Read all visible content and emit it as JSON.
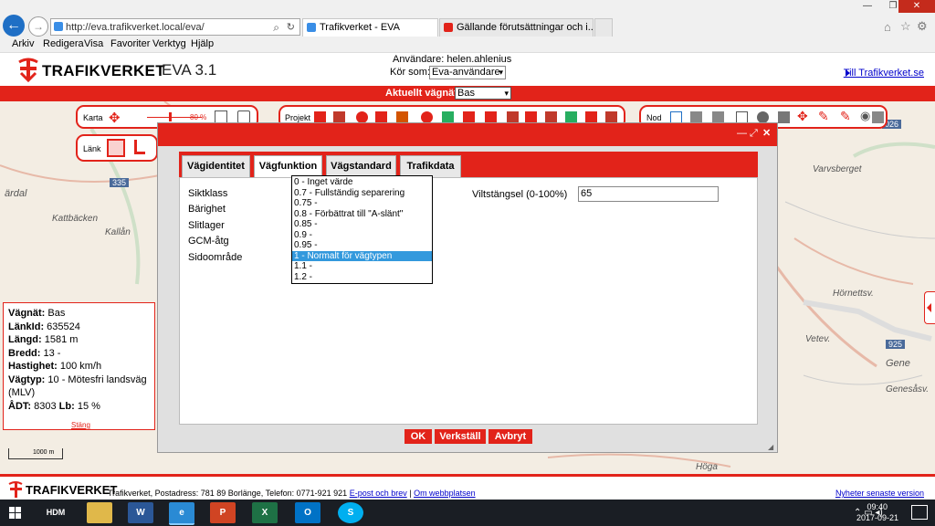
{
  "browser": {
    "url": "http://eva.trafikverket.local/eva/",
    "tabs": [
      {
        "label": "Trafikverket - EVA"
      },
      {
        "label": "Gällande förutsättningar och i..."
      }
    ],
    "menu": [
      "Arkiv",
      "Redigera",
      "Visa",
      "Favoriter",
      "Verktyg",
      "Hjälp"
    ]
  },
  "header": {
    "logo": "TRAFIKVERKET",
    "app_title": "EVA 3.1",
    "user": "Användare: helen.ahlenius",
    "role_label": "Kör som:",
    "role_value": "Eva-användare",
    "site_link": "Till Trafikverket.se",
    "net_label": "Aktuellt vägnät:",
    "net_value": "Bas"
  },
  "map": {
    "karta_label": "Karta",
    "zoom": "80 %",
    "lank_label": "Länk",
    "projekt_label": "Projekt",
    "nod_label": "Nod",
    "labels": [
      "ärdal",
      "Kattbäcken",
      "Kallån",
      "Varvsberget",
      "Hörnettsv.",
      "Vetev.",
      "Gene",
      "Genesåsv.",
      "Höga"
    ],
    "road_numbers": [
      "335",
      "026",
      "925"
    ],
    "scale": "1000 m"
  },
  "info": {
    "rows": [
      {
        "k": "Vägnät:",
        "v": " Bas"
      },
      {
        "k": "LänkId:",
        "v": " 635524"
      },
      {
        "k": "Längd:",
        "v": " 1581 m"
      },
      {
        "k": "Bredd:",
        "v": " 13 -"
      },
      {
        "k": "Hastighet:",
        "v": " 100 km/h"
      },
      {
        "k": "Vägtyp:",
        "v": " 10 - Mötesfri landsväg (MLV)"
      },
      {
        "k": "ÅDT:",
        "v": " 8303 "
      },
      {
        "k": "Lb:",
        "v": " 15 %"
      }
    ],
    "close": "Stäng"
  },
  "dialog": {
    "tabs": [
      "Vägidentitet",
      "Vägfunktion",
      "Vägstandard",
      "Trafikdata"
    ],
    "fields": [
      "Siktklass",
      "Bärighet",
      "Slitlager",
      "GCM-åtg",
      "Sidoområde"
    ],
    "vilt_label": "Viltstängsel (0-100%)",
    "vilt_value": "65",
    "dropdown": [
      "0 - Inget värde",
      "0.7 - Fullständig separering",
      "0.75 -",
      "0.8 - Förbättrat till \"A-slänt\"",
      "0.85 -",
      "0.9 -",
      "0.95 -",
      "1 - Normalt för vägtypen",
      "1.1 -",
      "1.2 -"
    ],
    "selected_index": 7,
    "buttons": {
      "ok": "OK",
      "apply": "Verkställ",
      "cancel": "Avbryt"
    }
  },
  "footer": {
    "logo": "TRAFIKVERKET",
    "text": "Trafikverket, Postadress: 781 89 Borlänge, Telefon: 0771-921 921",
    "email": "E-post och brev",
    "sep": " | ",
    "about": "Om webbplatsen",
    "news": "Nyheter senaste version"
  },
  "taskbar": {
    "time": "09:40",
    "date": "2017-09-21"
  },
  "colors": {
    "accent": "#e2231a",
    "link": "#0000cc",
    "selection": "#3399dd"
  }
}
